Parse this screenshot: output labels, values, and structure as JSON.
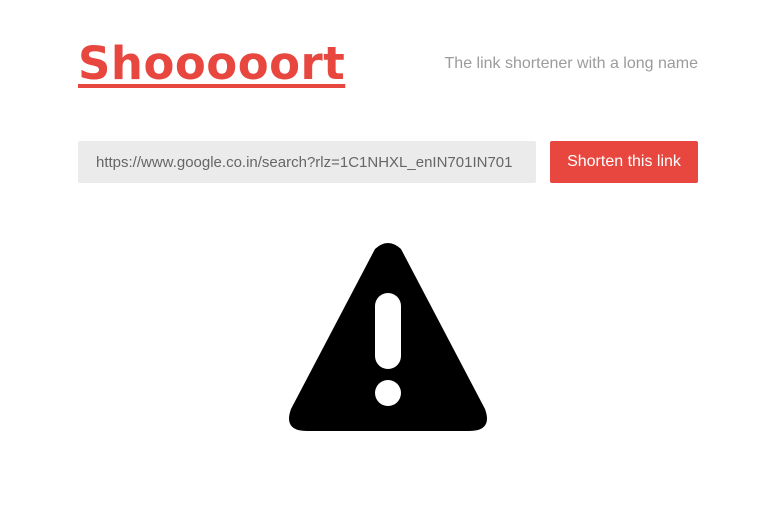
{
  "header": {
    "logo_text": "Shooooort",
    "tagline": "The link shortener with a long name"
  },
  "form": {
    "url_value": "https://www.google.co.in/search?rlz=1C1NHXL_enIN701IN701",
    "button_label": "Shorten this link"
  },
  "status": {
    "icon": "warning-icon"
  },
  "colors": {
    "brand": "#e8473f",
    "tagline": "#9b9b9b",
    "input_bg": "#ebebeb",
    "icon": "#000000"
  }
}
